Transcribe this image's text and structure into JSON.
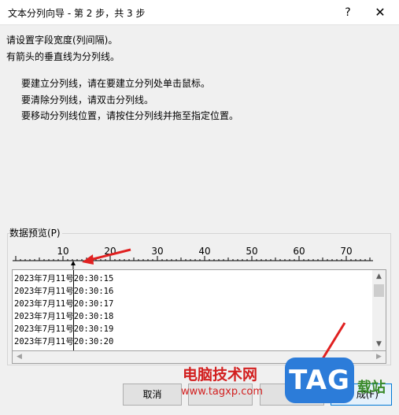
{
  "window": {
    "title": "文本分列向导 - 第 2 步，共 3 步",
    "help_symbol": "?",
    "close_symbol": "✕"
  },
  "instructions": {
    "line1": "请设置字段宽度(列间隔)。",
    "line2": "有箭头的垂直线为分列线。",
    "bullet1": "要建立分列线，请在要建立分列处单击鼠标。",
    "bullet2": "要清除分列线，请双击分列线。",
    "bullet3": "要移动分列线位置，请按住分列线并拖至指定位置。"
  },
  "preview": {
    "label": "数据预览(P)",
    "ruler_labels": [
      "10",
      "20",
      "30",
      "40",
      "50",
      "60",
      "70"
    ],
    "rows": [
      "2023年7月11号20:30:15",
      "2023年7月11号20:30:16",
      "2023年7月11号20:30:17",
      "2023年7月11号20:30:18",
      "2023年7月11号20:30:19",
      "2023年7月11号20:30:20"
    ]
  },
  "buttons": {
    "cancel": "取消",
    "finish": "成(F)"
  },
  "watermark": {
    "site_name": "电脑技术网",
    "url": "www.tagxp.com",
    "logo": "TAG",
    "side_text": "载站"
  },
  "colors": {
    "annotation_arrow": "#e02020",
    "logo_blue": "#2c7cd9"
  }
}
